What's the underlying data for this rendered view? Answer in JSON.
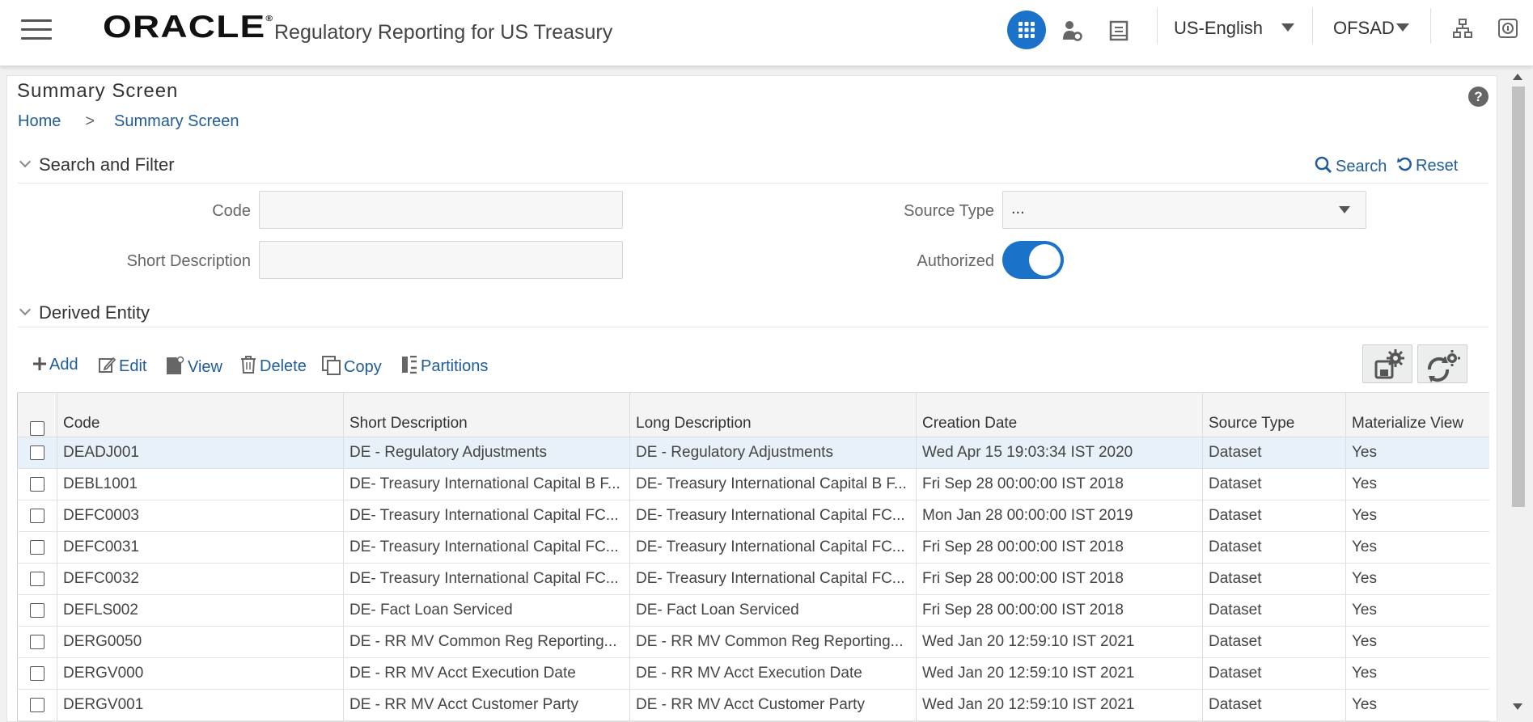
{
  "header": {
    "logo": "ORACLE",
    "logo_mark": "®",
    "app_title": "Regulatory Reporting for US Treasury",
    "language": "US-English",
    "user": "OFSAD"
  },
  "page": {
    "title": "Summary Screen",
    "help": "?",
    "breadcrumb": {
      "home": "Home",
      "separator": ">",
      "current": "Summary Screen"
    }
  },
  "search_filter": {
    "title": "Search and Filter",
    "search_label": "Search",
    "reset_label": "Reset",
    "code_label": "Code",
    "code_value": "",
    "short_desc_label": "Short Description",
    "short_desc_value": "",
    "source_type_label": "Source Type",
    "source_type_value": "...",
    "authorized_label": "Authorized",
    "authorized": true
  },
  "derived_entity": {
    "title": "Derived Entity",
    "toolbar": {
      "add": "Add",
      "edit": "Edit",
      "view": "View",
      "delete": "Delete",
      "copy": "Copy",
      "partitions": "Partitions"
    },
    "columns": [
      "Code",
      "Short Description",
      "Long Description",
      "Creation Date",
      "Source Type",
      "Materialize View"
    ],
    "rows": [
      {
        "code": "DEADJ001",
        "short": "DE - Regulatory Adjustments",
        "long": "DE - Regulatory Adjustments",
        "date": "Wed Apr 15 19:03:34 IST 2020",
        "source": "Dataset",
        "mv": "Yes"
      },
      {
        "code": "DEBL1001",
        "short": "DE- Treasury International Capital B F...",
        "long": "DE- Treasury International Capital B F...",
        "date": "Fri Sep 28 00:00:00 IST 2018",
        "source": "Dataset",
        "mv": "Yes"
      },
      {
        "code": "DEFC0003",
        "short": "DE- Treasury International Capital FC...",
        "long": "DE- Treasury International Capital FC...",
        "date": "Mon Jan 28 00:00:00 IST 2019",
        "source": "Dataset",
        "mv": "Yes"
      },
      {
        "code": "DEFC0031",
        "short": "DE- Treasury International Capital FC...",
        "long": "DE- Treasury International Capital FC...",
        "date": "Fri Sep 28 00:00:00 IST 2018",
        "source": "Dataset",
        "mv": "Yes"
      },
      {
        "code": "DEFC0032",
        "short": "DE- Treasury International Capital FC...",
        "long": "DE- Treasury International Capital FC...",
        "date": "Fri Sep 28 00:00:00 IST 2018",
        "source": "Dataset",
        "mv": "Yes"
      },
      {
        "code": "DEFLS002",
        "short": "DE- Fact Loan Serviced",
        "long": "DE- Fact Loan Serviced",
        "date": "Fri Sep 28 00:00:00 IST 2018",
        "source": "Dataset",
        "mv": "Yes"
      },
      {
        "code": "DERG0050",
        "short": "DE - RR MV Common Reg Reporting...",
        "long": "DE - RR MV Common Reg Reporting...",
        "date": "Wed Jan 20 12:59:10 IST 2021",
        "source": "Dataset",
        "mv": "Yes"
      },
      {
        "code": "DERGV000",
        "short": "DE - RR MV Acct Execution Date",
        "long": "DE - RR MV Acct Execution Date",
        "date": "Wed Jan 20 12:59:10 IST 2021",
        "source": "Dataset",
        "mv": "Yes"
      },
      {
        "code": "DERGV001",
        "short": "DE - RR MV Acct Customer Party",
        "long": "DE - RR MV Acct Customer Party",
        "date": "Wed Jan 20 12:59:10 IST 2021",
        "source": "Dataset",
        "mv": "Yes"
      }
    ]
  },
  "icons": {
    "menu": "hamburger-icon",
    "apps": "grid-apps-icon",
    "admin": "user-gear-icon",
    "reports": "book-icon",
    "hierarchy": "sitemap-icon",
    "about": "about-icon"
  },
  "colors": {
    "accent": "#1a73c8",
    "link": "#1f5c99",
    "row_highlight": "#e8f1fa"
  }
}
